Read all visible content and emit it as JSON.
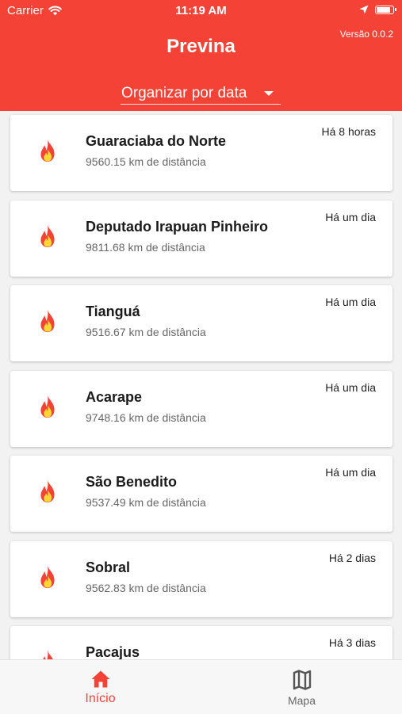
{
  "status_bar": {
    "carrier": "Carrier",
    "time": "11:19 AM"
  },
  "header": {
    "title": "Previna",
    "version": "Versão 0.0.2",
    "sort_label": "Organizar por data",
    "background_color": "#f44336"
  },
  "fires": [
    {
      "name": "Guaraciaba do Norte",
      "distance": "9560.15 km de distância",
      "time": "Há 8 horas",
      "icon": "fire-icon"
    },
    {
      "name": "Deputado Irapuan Pinheiro",
      "distance": "9811.68 km de distância",
      "time": "Há um dia",
      "icon": "fire-icon"
    },
    {
      "name": "Tianguá",
      "distance": "9516.67 km de distância",
      "time": "Há um dia",
      "icon": "fire-icon"
    },
    {
      "name": "Acarape",
      "distance": "9748.16 km de distância",
      "time": "Há um dia",
      "icon": "fire-icon"
    },
    {
      "name": "São Benedito",
      "distance": "9537.49 km de distância",
      "time": "Há um dia",
      "icon": "fire-icon"
    },
    {
      "name": "Sobral",
      "distance": "9562.83 km de distância",
      "time": "Há 2 dias",
      "icon": "fire-icon"
    },
    {
      "name": "Pacajus",
      "distance": "",
      "time": "Há 3 dias",
      "icon": "fire-icon"
    }
  ],
  "bottom_nav": {
    "home_label": "Início",
    "map_label": "Mapa",
    "active_color": "#f44336",
    "inactive_color": "#666666"
  }
}
